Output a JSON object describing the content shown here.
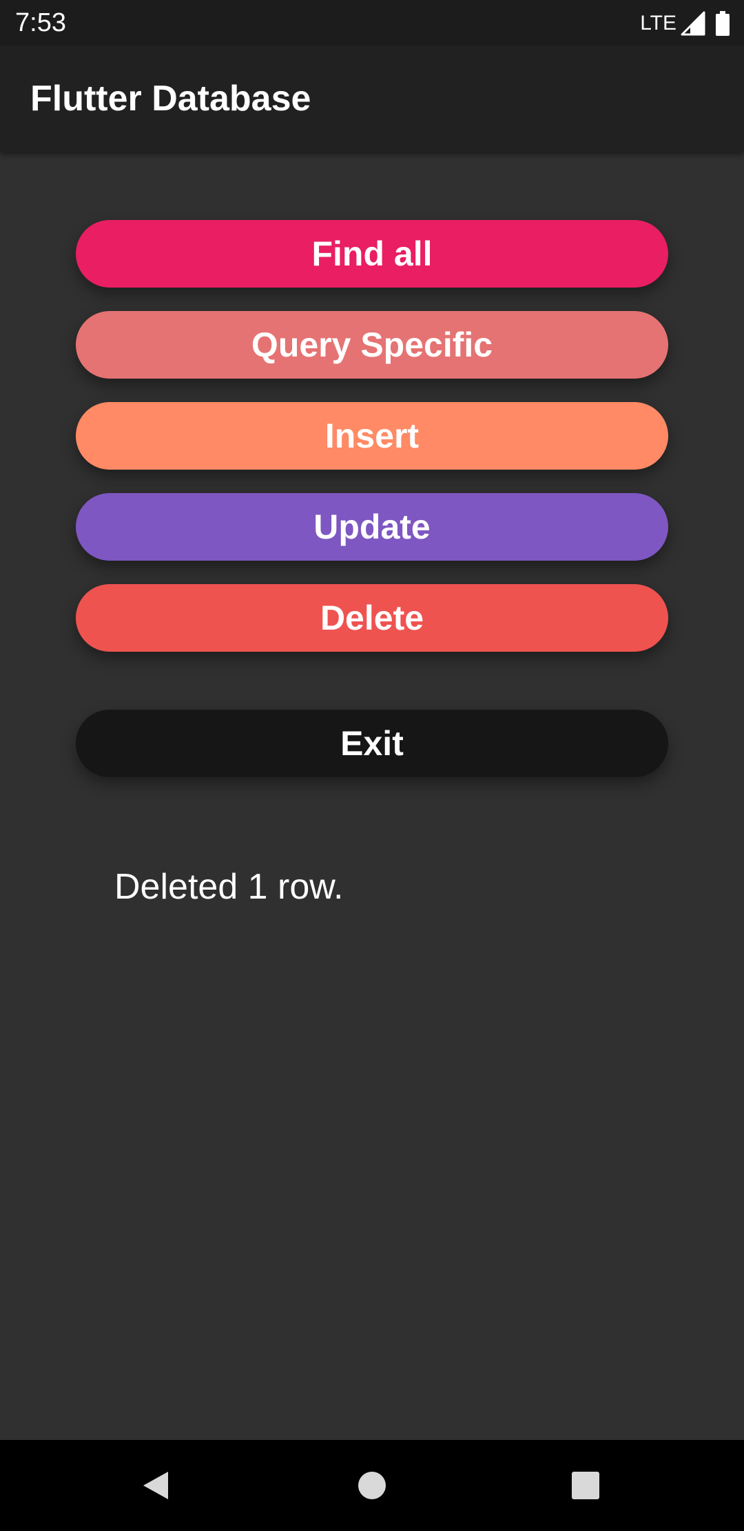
{
  "status_bar": {
    "time": "7:53",
    "network": "LTE",
    "icons": [
      "signal-icon",
      "battery-icon"
    ]
  },
  "app_bar": {
    "title": "Flutter Database"
  },
  "buttons": {
    "find_all": "Find all",
    "query_specific": "Query Specific",
    "insert": "Insert",
    "update": "Update",
    "delete": "Delete",
    "exit": "Exit"
  },
  "result": {
    "message": "Deleted 1 row."
  },
  "nav_bar": {
    "icons": [
      "back-icon",
      "home-icon",
      "recents-icon"
    ]
  },
  "colors": {
    "background": "#303030",
    "app_bar": "#212121",
    "find_all": "#e91e63",
    "query_specific": "#e57373",
    "insert": "#ff8a65",
    "update": "#7e57c2",
    "delete": "#ef5350",
    "exit": "#161616"
  }
}
